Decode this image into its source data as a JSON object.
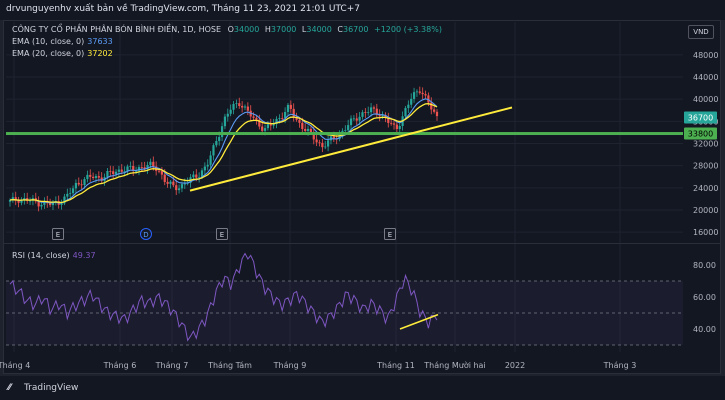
{
  "header": {
    "title": "drvunguyenhv xuất bản về TradingView.com, Tháng 11 23, 2021 21:01 UTC+7"
  },
  "legend": {
    "symbol": "CÔNG TY CỔ PHẦN PHÂN BÓN BÌNH ĐIỀN, 1D, HOSE",
    "open_label": "O",
    "open": "34000",
    "high_label": "H",
    "high": "37000",
    "low_label": "L",
    "low": "34000",
    "close_label": "C",
    "close": "36700",
    "change": "+1200 (+3.38%)",
    "ema10_label": "EMA (10, close, 0)",
    "ema10_value": "37633",
    "ema20_label": "EMA (20, close, 0)",
    "ema20_value": "37202",
    "rsi_label": "RSI (14, close)",
    "rsi_value": "49.37"
  },
  "currency": "VND",
  "price_axis": [
    "48000",
    "44000",
    "40000",
    "36000",
    "32000",
    "28000",
    "24000",
    "20000",
    "16000"
  ],
  "price_tags": {
    "last": "36700",
    "support": "33800"
  },
  "rsi_axis": [
    "80.00",
    "60.00",
    "40.00"
  ],
  "time_axis": [
    "Tháng 4",
    "Tháng 6",
    "Tháng 7",
    "Tháng Tám",
    "Tháng 9",
    "Tháng 11",
    "Tháng Mười hai",
    "2022",
    "Tháng 3"
  ],
  "events": [
    "E",
    "D",
    "E",
    "E"
  ],
  "footer": {
    "brand": "TradingView"
  },
  "colors": {
    "up": "#ef5350",
    "down": "#26a69a",
    "ema10": "#5b9cf6",
    "ema20": "#ffeb3b",
    "trendline": "#ffeb3b",
    "support": "#4caf50",
    "rsi": "#7e57c2",
    "price_up": "#26a69a",
    "change": "#26a69a"
  },
  "chart_data": [
    {
      "type": "candlestick",
      "title": "CÔNG TY CỔ PHẦN PHÂN BÓN BÌNH ĐIỀN, 1D, HOSE",
      "x": [
        "Tháng 4",
        "Tháng 6",
        "Tháng 7",
        "Tháng Tám",
        "Tháng 9",
        "Tháng 11",
        "Tháng Mười hai",
        "2022",
        "Tháng 3"
      ],
      "ylim": [
        16000,
        48000
      ],
      "close_path": [
        21500,
        22000,
        21800,
        21500,
        21200,
        21000,
        21500,
        22500,
        24500,
        25500,
        26000,
        25800,
        26500,
        27000,
        27500,
        27200,
        27800,
        28000,
        27500,
        25000,
        24000,
        24500,
        25500,
        26500,
        28000,
        32000,
        36000,
        38500,
        39500,
        37500,
        36000,
        34500,
        35500,
        37000,
        38500,
        36000,
        34500,
        33000,
        31500,
        32500,
        33500,
        35000,
        36500,
        37500,
        38000,
        37500,
        36000,
        34500,
        37500,
        40500,
        42000,
        39000,
        36700
      ],
      "ema10_last": 37633,
      "ema20_last": 37202,
      "support_level": 33800,
      "trendline": {
        "from": [
          "Tháng 7",
          23500
        ],
        "to": [
          "Tháng Mười hai",
          38500
        ]
      },
      "series": [
        {
          "name": "EMA (10, close, 0)",
          "last": 37633
        },
        {
          "name": "EMA (20, close, 0)",
          "last": 37202
        }
      ]
    },
    {
      "type": "line",
      "title": "RSI (14, close)",
      "ylim": [
        20,
        90
      ],
      "levels": [
        70,
        50,
        30
      ],
      "values": [
        68,
        64,
        58,
        55,
        60,
        52,
        56,
        50,
        55,
        58,
        62,
        55,
        50,
        48,
        46,
        52,
        58,
        56,
        60,
        56,
        50,
        42,
        34,
        40,
        48,
        62,
        72,
        68,
        80,
        88,
        76,
        66,
        60,
        55,
        58,
        62,
        56,
        50,
        44,
        48,
        54,
        62,
        58,
        52,
        56,
        52,
        46,
        58,
        72,
        64,
        50,
        44,
        49.37
      ],
      "last": 49.37
    }
  ]
}
